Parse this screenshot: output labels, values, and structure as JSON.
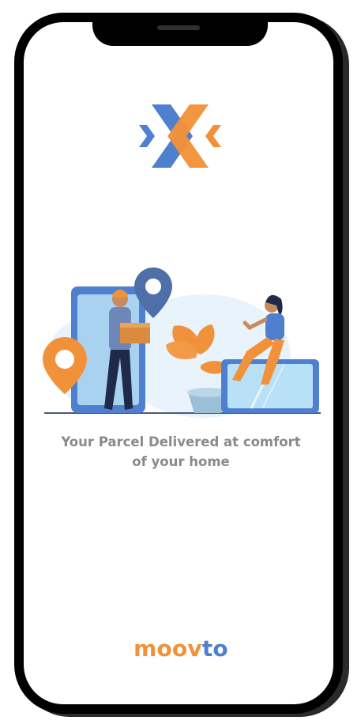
{
  "app": {
    "brand_part_1": "moov",
    "brand_part_2": "to",
    "logo_icon": "double-chevron-x-logo-icon"
  },
  "splash": {
    "tagline_line_1": "Your Parcel Delivered at comfort",
    "tagline_line_2": "of your home",
    "illustration": "parcel-delivery-illustration"
  },
  "colors": {
    "brand_orange": "#f1923a",
    "brand_blue": "#4f7fcf",
    "tagline_gray": "#8a8a8a",
    "frame_black": "#000000",
    "screen_white": "#ffffff"
  }
}
